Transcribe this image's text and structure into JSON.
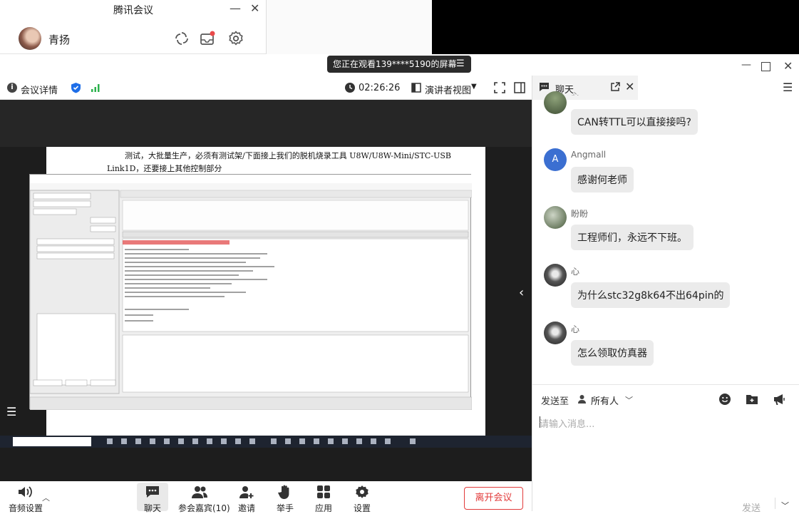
{
  "mini_window": {
    "title": "腾讯会议",
    "user_name": "青扬"
  },
  "share_banner": {
    "text": "您正在观看139****5190的屏幕"
  },
  "toolbar": {
    "meeting_info": "会议详情",
    "timer": "02:26:26",
    "view_mode": "演讲者视图"
  },
  "slide": {
    "line1": "测试，大批量生产，必须有测试架/下面接上我们的脱机烧录工具  U8W/U8W-Mini/STC-USB",
    "line2": "Link1D，还要接上其他控制部分"
  },
  "bottom_bar": {
    "audio": "音频设置",
    "chat": "聊天",
    "participants": "参会嘉宾(10)",
    "invite": "邀请",
    "raise_hand": "举手",
    "apps": "应用",
    "settings": "设置",
    "leave": "离开会议"
  },
  "chat": {
    "title": "聊天",
    "partial_name": "心",
    "messages": [
      {
        "sender": "",
        "text": "CAN转TTL可以直接接吗?"
      },
      {
        "sender": "Angmall",
        "avatar_letter": "A",
        "text": "感谢何老师"
      },
      {
        "sender": "盼盼",
        "text": "工程师们，永远不下班。"
      },
      {
        "sender": "心",
        "text": "为什么stc32g8k64不出64pin的"
      },
      {
        "sender": "心",
        "text": "怎么领取仿真器"
      }
    ],
    "send_to_label": "发送至",
    "send_to_target": "所有人",
    "input_placeholder": "请输入消息...",
    "send_button": "发送"
  },
  "colors": {
    "accent_blue": "#1e6ee8",
    "leave_red": "#e23b3b",
    "signal_green": "#2bb24c"
  }
}
